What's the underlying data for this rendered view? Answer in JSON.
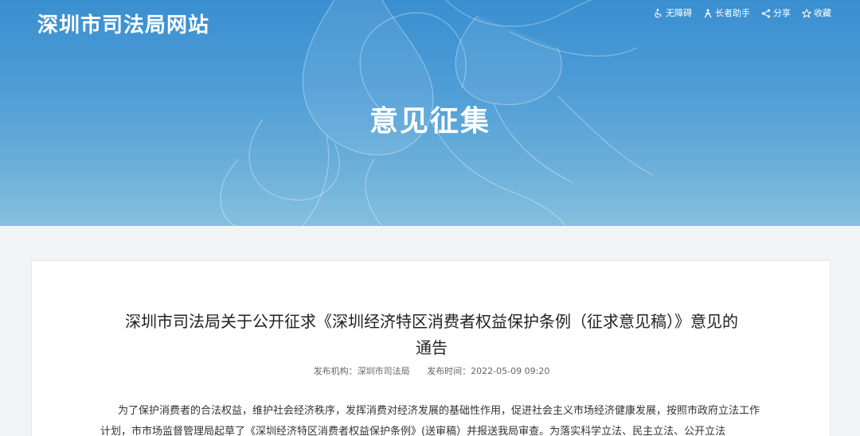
{
  "header": {
    "site_title": "深圳市司法局网站",
    "tools": [
      {
        "label": "无障碍",
        "icon": "wheelchair-icon"
      },
      {
        "label": "长者助手",
        "icon": "elder-assistant-icon"
      },
      {
        "label": "分享",
        "icon": "share-icon"
      },
      {
        "label": "收藏",
        "icon": "star-icon"
      }
    ],
    "banner_heading": "意见征集"
  },
  "article": {
    "title": "深圳市司法局关于公开征求《深圳经济特区消费者权益保护条例（征求意见稿）》意见的通告",
    "publisher_label": "发布机构：",
    "publisher": "深圳市司法局",
    "time_label": "发布时间：",
    "time": "2022-05-09 09:20",
    "body": "为了保护消费者的合法权益，维护社会经济秩序，发挥消费对经济发展的基础性作用，促进社会主义市场经济健康发展，按照市政府立法工作计划，市市场监督管理局起草了《深圳经济特区消费者权益保护条例》(送审稿）并报送我局审查。为落实科学立法、民主立法、公开立法"
  },
  "colors": {
    "banner_top": "#3a8fd0",
    "banner_bottom": "#86bfdf",
    "page_background": "#f2f3f5"
  }
}
